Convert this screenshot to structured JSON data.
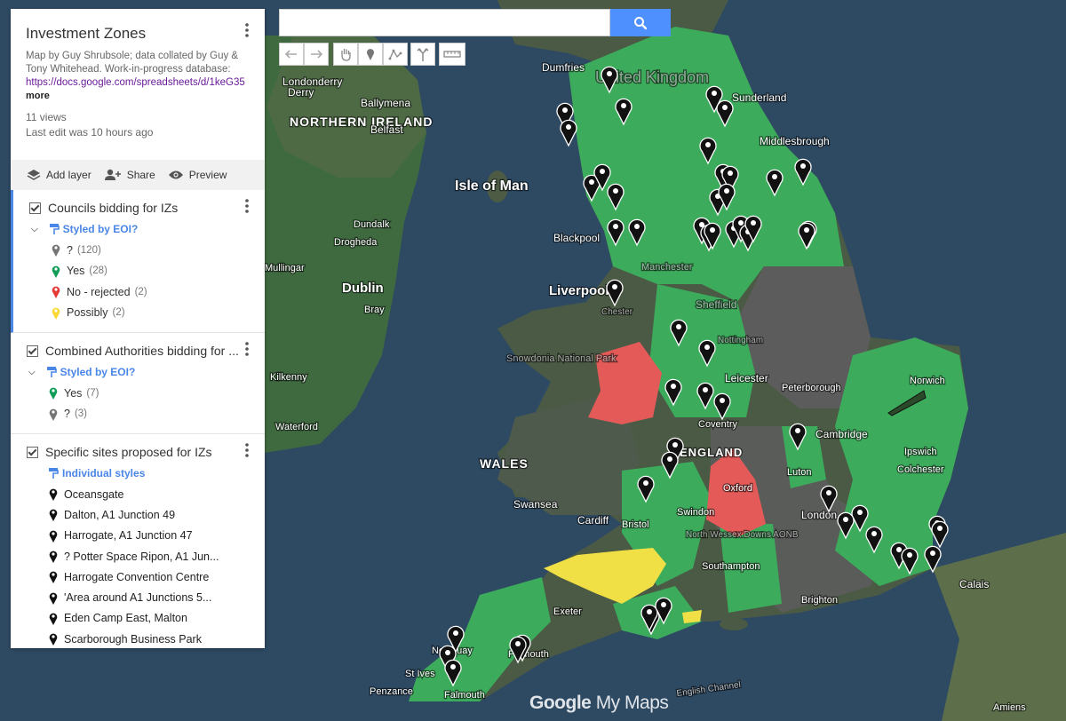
{
  "panel": {
    "title": "Investment Zones",
    "description": "Map by Guy Shrubsole; data collated by Guy & Tony Whitehead. Work-in-progress database:",
    "link": "https://docs.google.com/spreadsheets/d/1keG35",
    "more": "more",
    "views": "11 views",
    "last_edit": "Last edit was 10 hours ago",
    "toolbar": {
      "add_layer": "Add layer",
      "share": "Share",
      "preview": "Preview"
    },
    "layers": [
      {
        "name": "Councils bidding for IZs",
        "style": "Styled by EOI?",
        "legend": [
          {
            "label": "?",
            "count": "(120)",
            "color": "#757575"
          },
          {
            "label": "Yes",
            "count": "(28)",
            "color": "#0f9d58"
          },
          {
            "label": "No - rejected",
            "count": "(2)",
            "color": "#e53935"
          },
          {
            "label": "Possibly",
            "count": "(2)",
            "color": "#fdd835"
          }
        ]
      },
      {
        "name": "Combined Authorities bidding for ...",
        "style": "Styled by EOI?",
        "legend": [
          {
            "label": "Yes",
            "count": "(7)",
            "color": "#0f9d58"
          },
          {
            "label": "?",
            "count": "(3)",
            "color": "#757575"
          }
        ]
      },
      {
        "name": "Specific sites proposed for IZs",
        "style": "Individual styles",
        "sites": [
          "Oceansgate",
          "Dalton, A1 Junction 49",
          "Harrogate, A1 Junction 47",
          "? Potter Space Ripon, A1 Jun...",
          "Harrogate Convention Centre",
          "'Area around A1 Junctions 5...",
          "Eden Camp East, Malton",
          "Scarborough Business Park"
        ]
      }
    ]
  },
  "map": {
    "labels": {
      "dumfries": "Dumfries",
      "united_kingdom": "United Kingdom",
      "londonderry": "Londonderry",
      "derry": "Derry",
      "ballymena": "Ballymena",
      "sunderland": "Sunderland",
      "northern_ireland": "NORTHERN IRELAND",
      "belfast": "Belfast",
      "middlesbrough": "Middlesbrough",
      "isle_of_man": "Isle of Man",
      "dundalk": "Dundalk",
      "blackpool": "Blackpool",
      "drogheda": "Drogheda",
      "mullingar": "Mullingar",
      "liverpool": "Liverpool",
      "dublin": "Dublin",
      "bray": "Bray",
      "sheffield": "Sheffield",
      "kilkenny": "Kilkenny",
      "snowdonia": "Snowdonia National Park",
      "leicester": "Leicester",
      "peterborough": "Peterborough",
      "norwich": "Norwich",
      "waterford": "Waterford",
      "coventry": "Coventry",
      "cambridge": "Cambridge",
      "wales": "WALES",
      "england": "ENGLAND",
      "ipswich": "Ipswich",
      "oxford": "Oxford",
      "luton": "Luton",
      "colchester": "Colchester",
      "swansea": "Swansea",
      "cardiff": "Cardiff",
      "london": "London",
      "bristol": "Bristol",
      "swindon": "Swindon",
      "north_wessex": "North Wessex Downs AONB",
      "southampton": "Southampton",
      "brighton": "Brighton",
      "calais": "Calais",
      "exeter": "Exeter",
      "plymouth": "Plymouth",
      "newquay": "Newquay",
      "st_ives": "St Ives",
      "penzance": "Penzance",
      "falmouth": "Falmouth",
      "english_channel": "English Channel",
      "amiens": "Amiens",
      "nottingham": "Nottingham",
      "manchester": "Manchester",
      "chester": "Chester"
    },
    "colors": {
      "sea": "#2e4a63",
      "land": "#4b5a44",
      "yes_green": "#3cab5c",
      "rejected_red": "#e35a58",
      "possibly_yellow": "#f0e046",
      "unknown_grey": "#5c5c5c",
      "france": "#5c6e4a",
      "ireland": "#3f6a40"
    },
    "brand": {
      "google": "Google",
      "mymaps": "My Maps"
    }
  },
  "search": {
    "value": "",
    "icon": "search-icon"
  },
  "tools": [
    "undo-icon",
    "redo-icon",
    "hand-icon",
    "marker-icon",
    "draw-line-icon",
    "directions-icon",
    "ruler-icon"
  ]
}
